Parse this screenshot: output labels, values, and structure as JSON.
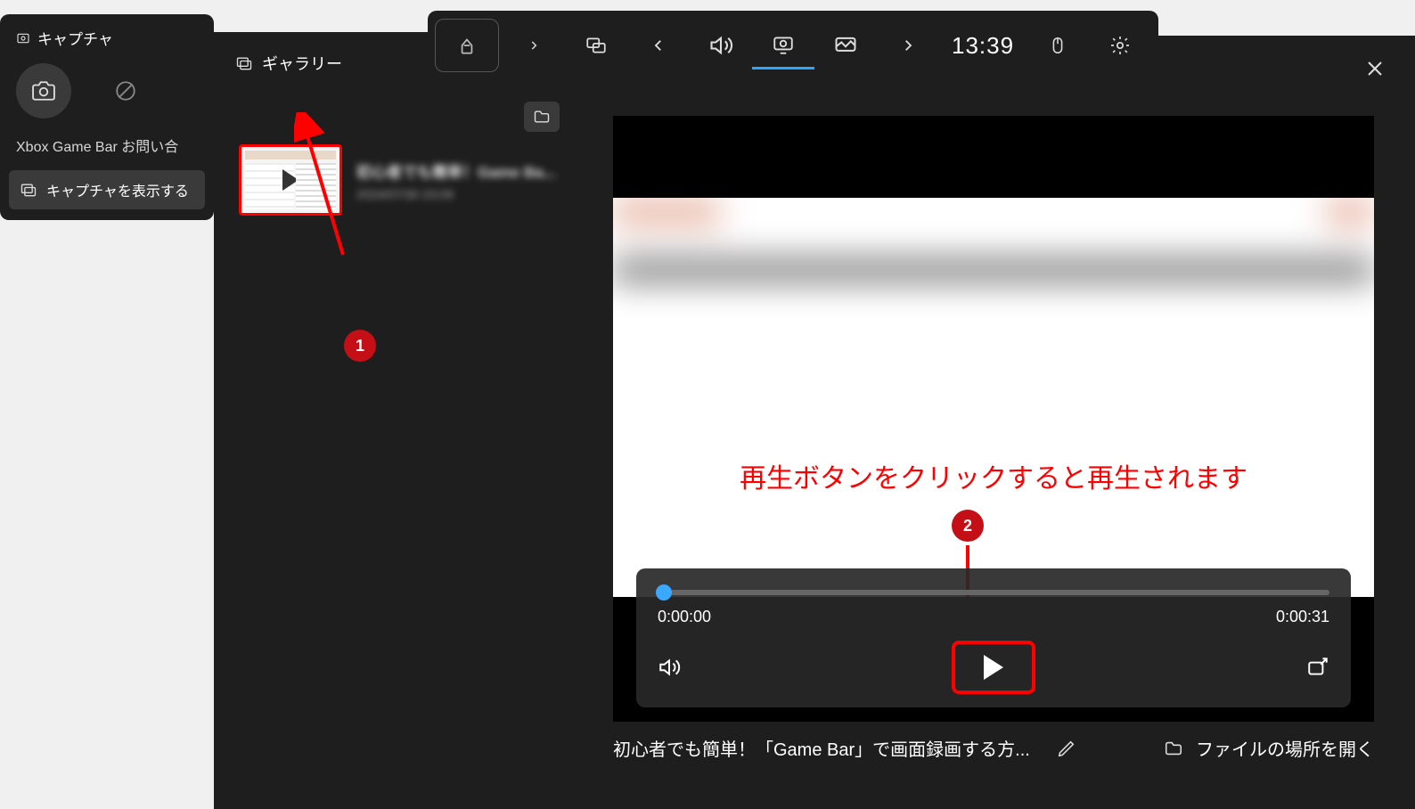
{
  "capture_widget": {
    "title": "キャプチャ",
    "feedback": "Xbox Game Bar お問い合",
    "show_captures": "キャプチャを表示する"
  },
  "gallery": {
    "title": "ギャラリー",
    "item": {
      "line1": "初心者でも簡単！Game Ba...",
      "line2": "2024/07/30 23:09"
    }
  },
  "toolbar": {
    "clock": "13:39"
  },
  "annotations": {
    "marker1": "1",
    "marker2": "2",
    "play_hint": "再生ボタンをクリックすると再生されます"
  },
  "player": {
    "current_time": "0:00:00",
    "duration": "0:00:31"
  },
  "footer": {
    "title": "初心者でも簡単！「Game Bar」で画面録画する方...",
    "open_location": "ファイルの場所を開く"
  }
}
